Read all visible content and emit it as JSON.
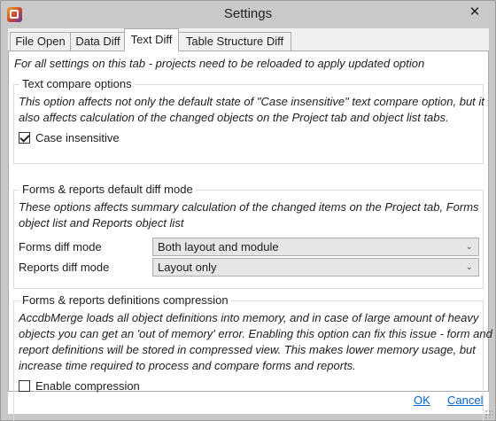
{
  "window": {
    "title": "Settings",
    "close_symbol": "✕"
  },
  "tabs": [
    {
      "label": "File Open"
    },
    {
      "label": "Data Diff"
    },
    {
      "label": "Text Diff",
      "active": true
    },
    {
      "label": "Table Structure Diff"
    }
  ],
  "text_diff": {
    "note": "For all settings on this tab - projects need to be reloaded to apply updated option",
    "text_compare": {
      "title": "Text compare options",
      "desc_lines": [
        "This option affects not only the default state of \"Case insensitive\" text compare option, but it",
        "also affects calculation of the changed objects on the Project tab and object list tabs."
      ],
      "case_insensitive_label": "Case insensitive",
      "case_insensitive_checked": true
    },
    "forms_reports_mode": {
      "title": "Forms & reports default diff mode",
      "desc_lines": [
        "These options affects summary calculation of the changed items on the Project tab, Forms",
        "object list and Reports object list"
      ],
      "forms_label": "Forms diff mode",
      "forms_value": "Both layout and module",
      "reports_label": "Reports diff mode",
      "reports_value": "Layout only"
    },
    "compression": {
      "title": "Forms & reports definitions compression",
      "desc_lines": [
        "AccdbMerge loads all object definitions into memory, and in case of large amount of heavy",
        "objects you can get an 'out of memory' error. Enabling this option can fix this issue - form and",
        "report definitions will be stored in compressed view. This makes lower memory usage, but",
        "increase time required to process and compare forms and reports."
      ],
      "enable_label": "Enable compression",
      "enable_checked": false
    }
  },
  "footer": {
    "ok_label": "OK",
    "cancel_label": "Cancel"
  },
  "colors": {
    "chrome": "#c9c9c9",
    "link": "#0066cc",
    "dropdown_bg": "#e6e6e6"
  }
}
